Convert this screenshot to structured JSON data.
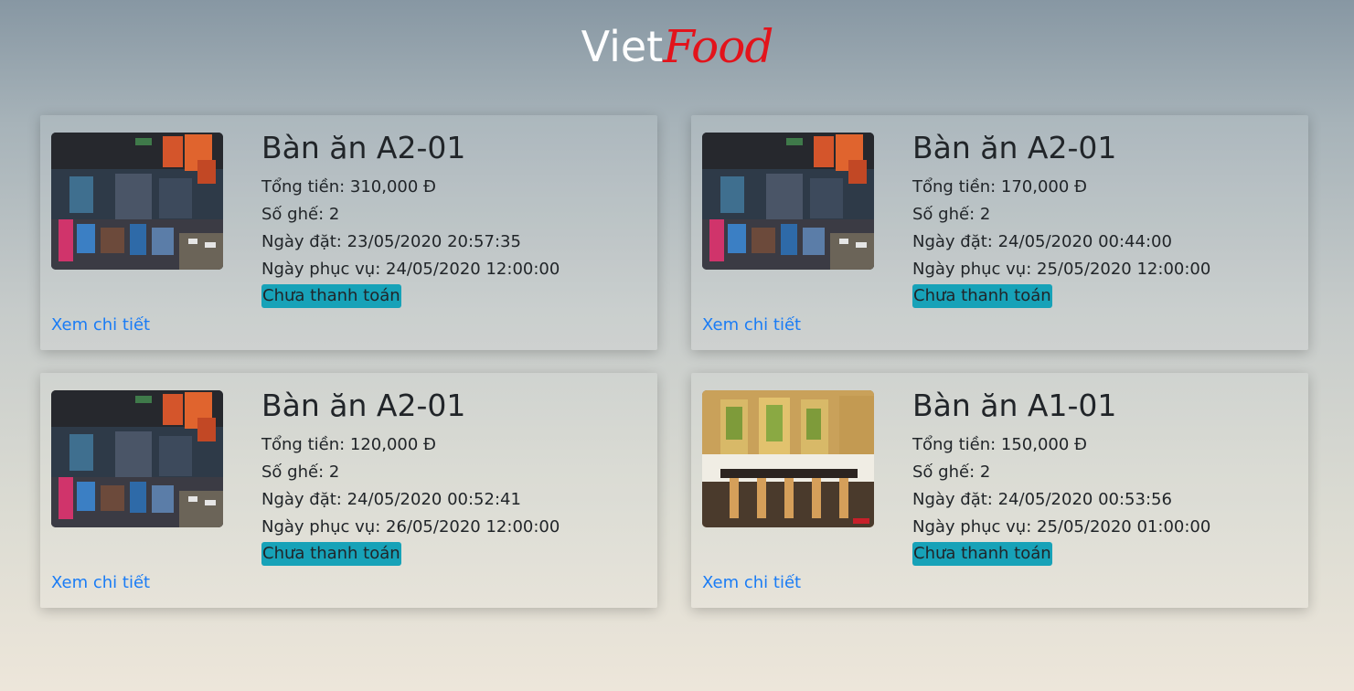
{
  "brand": {
    "part1": "Viet",
    "part2": "Food"
  },
  "labels": {
    "total": "Tổng tiền: ",
    "seats": "Số ghế: ",
    "order_date": "Ngày đặt: ",
    "serve_date": "Ngày phục vụ: "
  },
  "orders": [
    {
      "table_name": "Bàn ăn A2-01",
      "total": "310,000 Đ",
      "seats": "2",
      "order_date": "23/05/2020 20:57:35",
      "serve_date": "24/05/2020 12:00:00",
      "status": "Chưa thanh toán",
      "link": "Xem chi tiết",
      "image": "restaurant-dark-interior"
    },
    {
      "table_name": "Bàn ăn A2-01",
      "total": "170,000 Đ",
      "seats": "2",
      "order_date": "24/05/2020 00:44:00",
      "serve_date": "25/05/2020 12:00:00",
      "status": "Chưa thanh toán",
      "link": "Xem chi tiết",
      "image": "restaurant-dark-interior"
    },
    {
      "table_name": "Bàn ăn A2-01",
      "total": "120,000 Đ",
      "seats": "2",
      "order_date": "24/05/2020 00:52:41",
      "serve_date": "26/05/2020 12:00:00",
      "status": "Chưa thanh toán",
      "link": "Xem chi tiết",
      "image": "restaurant-dark-interior"
    },
    {
      "table_name": "Bàn ăn A1-01",
      "total": "150,000 Đ",
      "seats": "2",
      "order_date": "24/05/2020 00:53:56",
      "serve_date": "25/05/2020 01:00:00",
      "status": "Chưa thanh toán",
      "link": "Xem chi tiết",
      "image": "restaurant-bright-interior"
    }
  ],
  "colors": {
    "brand_food": "#e3131b",
    "badge_bg": "#17a2b8",
    "link": "#1a7cf5"
  }
}
